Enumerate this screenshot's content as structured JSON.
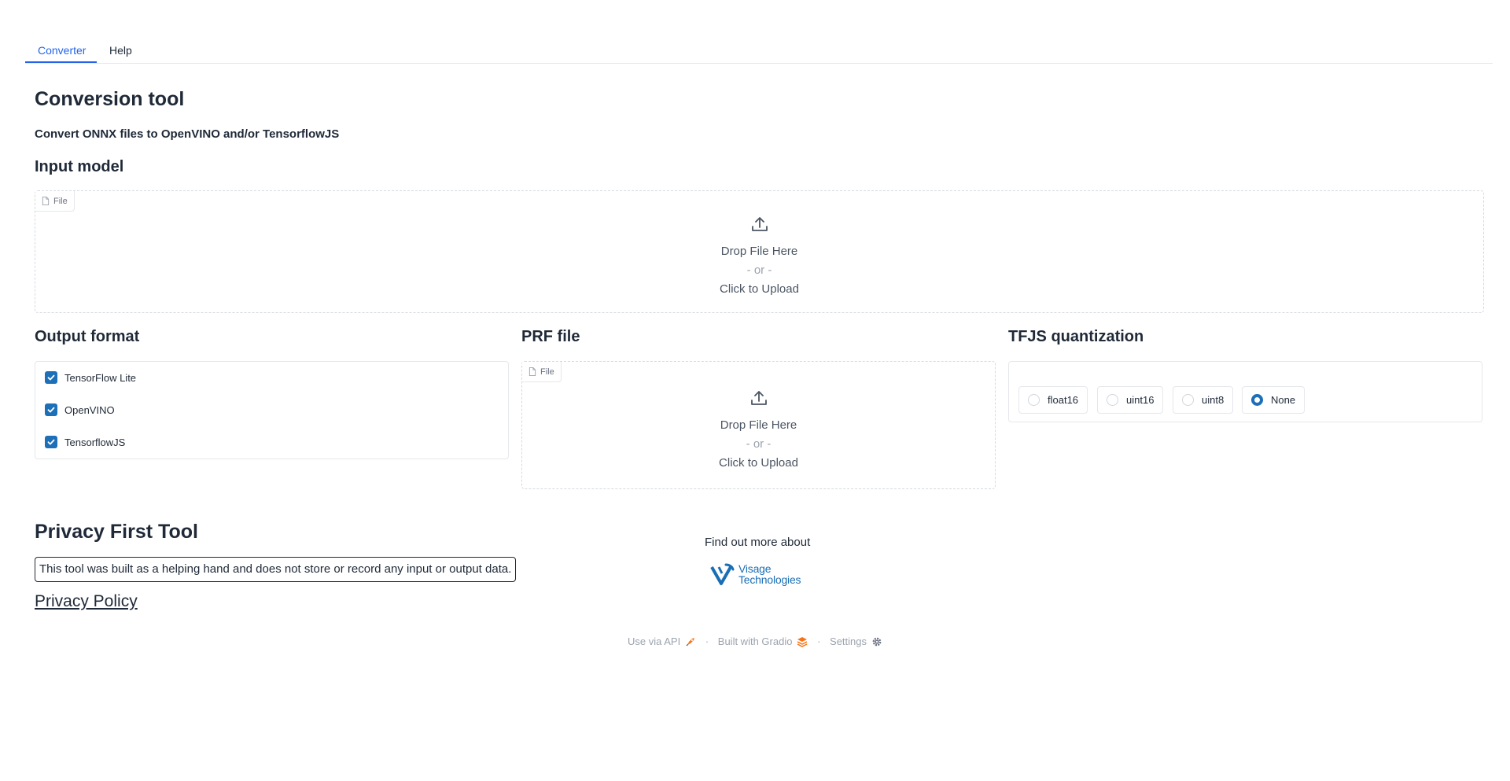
{
  "tabs": [
    {
      "label": "Converter",
      "active": true
    },
    {
      "label": "Help",
      "active": false
    }
  ],
  "title": "Conversion tool",
  "subtitle": "Convert ONNX files to OpenVINO and/or TensorflowJS",
  "input_model": {
    "heading": "Input model",
    "chip": "File",
    "drop_text": "Drop File Here",
    "or_text": "- or -",
    "click_text": "Click to Upload"
  },
  "output_format": {
    "heading": "Output format",
    "options": [
      {
        "label": "TensorFlow Lite",
        "checked": true
      },
      {
        "label": "OpenVINO",
        "checked": true
      },
      {
        "label": "TensorflowJS",
        "checked": true
      }
    ]
  },
  "prf_file": {
    "heading": "PRF file",
    "chip": "File",
    "drop_text": "Drop File Here",
    "or_text": "- or -",
    "click_text": "Click to Upload"
  },
  "tfjs_quantization": {
    "heading": "TFJS quantization",
    "options": [
      {
        "label": "float16",
        "selected": false
      },
      {
        "label": "uint16",
        "selected": false
      },
      {
        "label": "uint8",
        "selected": false
      },
      {
        "label": "None",
        "selected": true
      }
    ]
  },
  "privacy": {
    "title": "Privacy First Tool",
    "text": "This tool was built as a helping hand and does not store or record any input or output data.",
    "link": "Privacy Policy"
  },
  "promo": {
    "find_more": "Find out more about",
    "logo_line1": "Visage",
    "logo_line2": "Technologies"
  },
  "footer": {
    "api": "Use via API",
    "built": "Built with Gradio",
    "settings": "Settings",
    "separator": "·"
  },
  "colors": {
    "accent": "#1d6fb8",
    "tab_active": "#2563eb"
  }
}
